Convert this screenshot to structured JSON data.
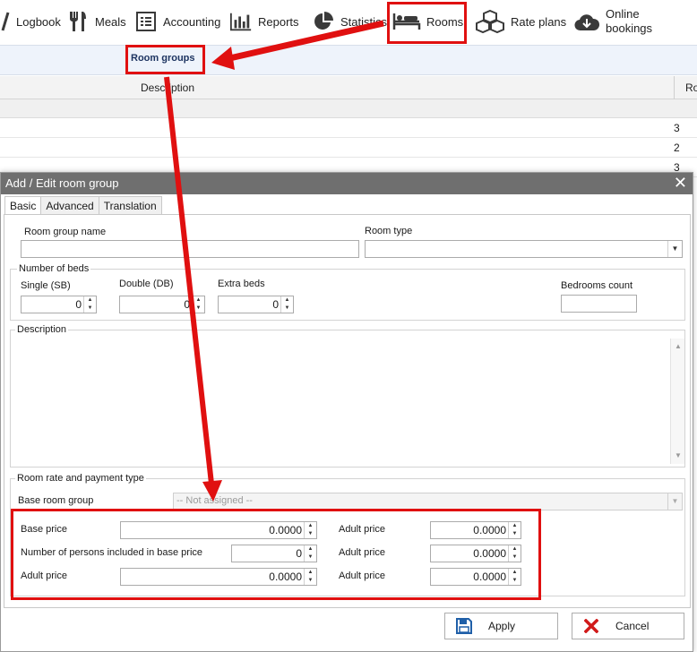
{
  "toolbar": {
    "items": [
      {
        "id": "logbook",
        "label": "Logbook",
        "icon": "book-icon"
      },
      {
        "id": "meals",
        "label": "Meals",
        "icon": "fork-knife-icon"
      },
      {
        "id": "accounting",
        "label": "Accounting",
        "icon": "ledger-icon"
      },
      {
        "id": "reports",
        "label": "Reports",
        "icon": "bar-chart-icon"
      },
      {
        "id": "statistics",
        "label": "Statistics",
        "icon": "pie-chart-icon"
      },
      {
        "id": "rooms",
        "label": "Rooms",
        "icon": "bed-icon"
      },
      {
        "id": "rate_plans",
        "label": "Rate plans",
        "icon": "boxes-icon"
      },
      {
        "id": "online_bookings",
        "label_line1": "Online",
        "label_line2": "bookings",
        "icon": "cloud-download-icon"
      }
    ]
  },
  "subbar": {
    "active_tab": "Room groups"
  },
  "grid": {
    "columns": {
      "description": "Description",
      "rooms": "Ro"
    },
    "rows": [
      {
        "rooms": "3"
      },
      {
        "rooms": "2"
      },
      {
        "rooms": "3"
      }
    ]
  },
  "dialog": {
    "title": "Add / Edit room group",
    "close_glyph": "✕",
    "tabs": [
      "Basic",
      "Advanced",
      "Translation"
    ],
    "room_group_name_label": "Room group name",
    "room_group_name_value": "",
    "room_type_label": "Room type",
    "room_type_value": "",
    "beds": {
      "legend": "Number of beds",
      "single_label": "Single (SB)",
      "single_value": "0",
      "double_label": "Double (DB)",
      "double_value": "0",
      "extra_label": "Extra beds",
      "extra_value": "0",
      "bedrooms_label": "Bedrooms count",
      "bedrooms_value": ""
    },
    "description_legend": "Description",
    "rate": {
      "legend": "Room rate and payment type",
      "base_room_group_label": "Base room group",
      "base_room_group_value": "-- Not assigned --",
      "base_price_label": "Base price",
      "base_price_value": "0.0000",
      "persons_label": "Number of persons included in base price",
      "persons_value": "0",
      "adult_price_label": "Adult price",
      "adult_price_value": "0.0000",
      "right_rows": [
        {
          "label": "Adult price",
          "value": "0.0000"
        },
        {
          "label": "Adult price",
          "value": "0.0000"
        },
        {
          "label": "Adult price",
          "value": "0.0000"
        }
      ]
    },
    "apply_label": "Apply",
    "cancel_label": "Cancel"
  },
  "colors": {
    "annotation_red": "#e01010",
    "title_bar": "#6f6f6f",
    "apply_icon_blue": "#1f5fa8",
    "cancel_icon_red": "#d11a1a"
  }
}
